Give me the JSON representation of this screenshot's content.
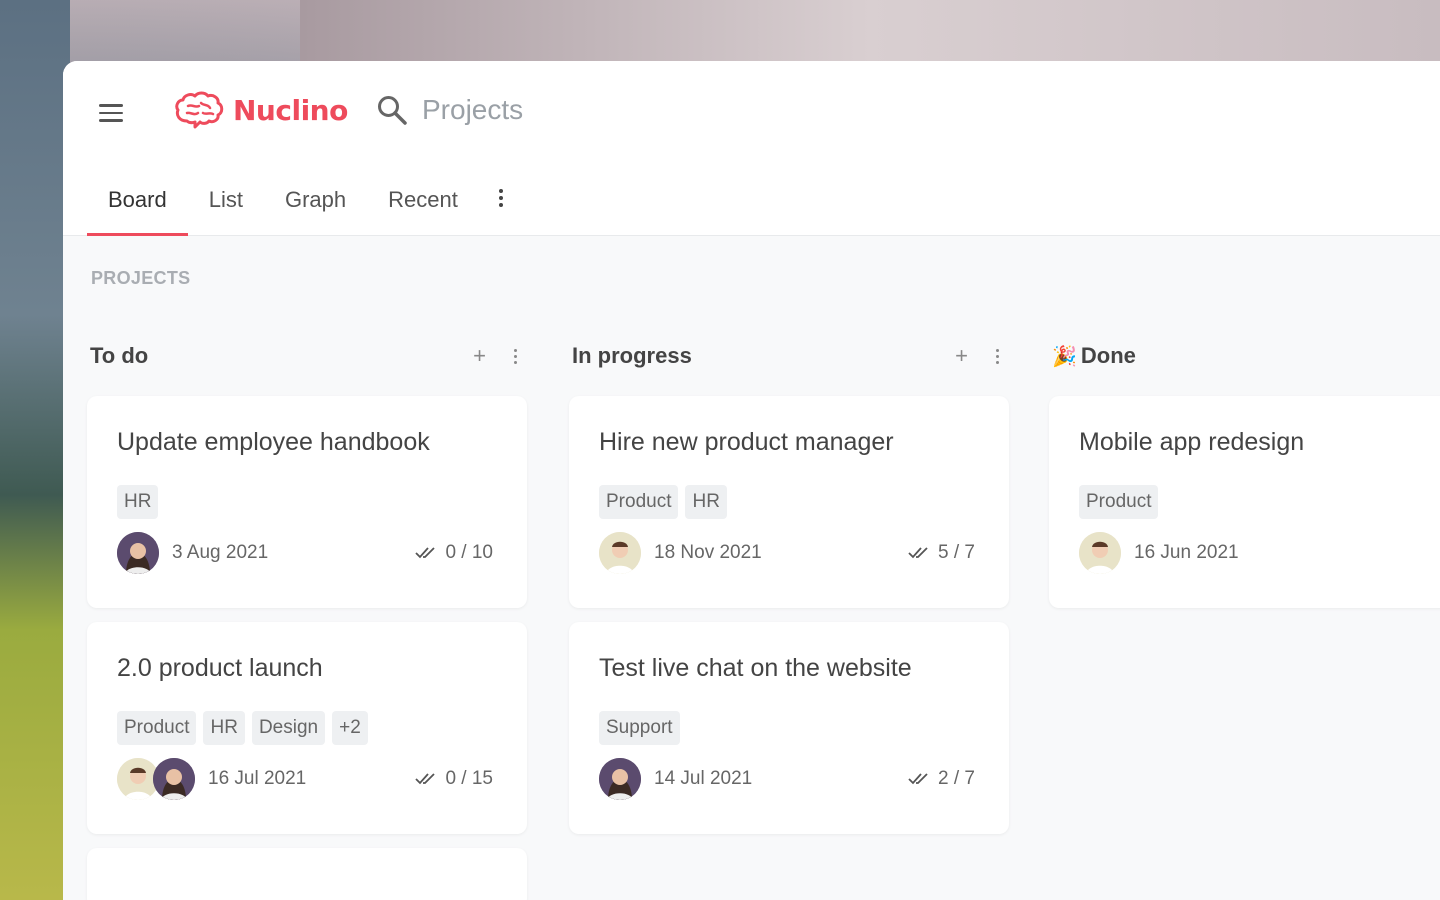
{
  "app": {
    "name": "Nuclino",
    "brand_color": "#ee4b5c",
    "search_placeholder": "Projects"
  },
  "tabs": [
    {
      "label": "Board",
      "active": true
    },
    {
      "label": "List",
      "active": false
    },
    {
      "label": "Graph",
      "active": false
    },
    {
      "label": "Recent",
      "active": false
    }
  ],
  "section_title": "PROJECTS",
  "columns": [
    {
      "title": "To do",
      "cards": [
        {
          "title": "Update employee handbook",
          "tags": [
            "HR"
          ],
          "date": "3 Aug 2021",
          "progress": "0 / 10",
          "avatars": [
            "female"
          ]
        },
        {
          "title": "2.0 product launch",
          "tags": [
            "Product",
            "HR",
            "Design",
            "+2"
          ],
          "date": "16 Jul 2021",
          "progress": "0 / 15",
          "avatars": [
            "male",
            "female"
          ]
        }
      ]
    },
    {
      "title": "In progress",
      "cards": [
        {
          "title": "Hire new product manager",
          "tags": [
            "Product",
            "HR"
          ],
          "date": "18 Nov 2021",
          "progress": "5 / 7",
          "avatars": [
            "male"
          ]
        },
        {
          "title": "Test live chat on the website",
          "tags": [
            "Support"
          ],
          "date": "14 Jul 2021",
          "progress": "2 / 7",
          "avatars": [
            "female"
          ]
        }
      ]
    },
    {
      "title": "Done",
      "emoji": "🎉",
      "cards": [
        {
          "title": "Mobile app redesign",
          "tags": [
            "Product"
          ],
          "date": "16 Jun 2021",
          "progress": "",
          "avatars": [
            "male"
          ]
        }
      ]
    }
  ]
}
